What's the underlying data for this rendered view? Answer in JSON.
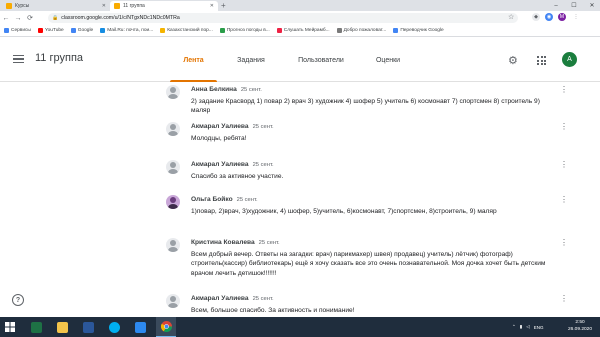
{
  "browser": {
    "tabs": [
      {
        "label": "Курсы"
      },
      {
        "label": "11 группа"
      }
    ],
    "new_tab": "+",
    "window_controls": {
      "minimize": "–",
      "maximize": "☐",
      "close": "✕"
    },
    "url": "classroom.google.com/u/1/c/NTgxNDc1NDc0MTRa",
    "profile_initial": "M",
    "bookmarks": [
      {
        "label": "Сервисы",
        "color": "#4285f4"
      },
      {
        "label": "YouTube",
        "color": "#ff0000"
      },
      {
        "label": "Google",
        "color": "#4285f4"
      },
      {
        "label": "Mail.Ru: почта, пои...",
        "color": "#168de2"
      },
      {
        "label": "Казахстанский пор...",
        "color": "#f5b400"
      },
      {
        "label": "Прогноз погоды в...",
        "color": "#2a9d4a"
      },
      {
        "label": "Слушать Мейрамб...",
        "color": "#e24"
      },
      {
        "label": "Добро пожаловат...",
        "color": "#7a7a7a"
      },
      {
        "label": "Переводчик Google",
        "color": "#4285f4"
      }
    ]
  },
  "classroom": {
    "class_name": "11 группа",
    "tabs": [
      {
        "label": "Лента",
        "active": true
      },
      {
        "label": "Задания",
        "active": false
      },
      {
        "label": "Пользователи",
        "active": false
      },
      {
        "label": "Оценки",
        "active": false
      }
    ],
    "user_initial": "A",
    "accent_color": "#e37400"
  },
  "comments": [
    {
      "author": "Анна Белкина",
      "date": "25 сент.",
      "text": "2) задание  Красворд  1) повар 2) врач 3) художник 4) шофер 5) учитель 6) космонавт 7) спортсмен 8) строитель 9) маляр",
      "photo": false
    },
    {
      "author": "Акмарал Уалиева",
      "date": "25 сент.",
      "text": "Молодцы,  ребята!",
      "photo": false
    },
    {
      "author": "Акмарал Уалиева",
      "date": "25 сент.",
      "text": "Спасибо за активное участие.",
      "photo": false
    },
    {
      "author": "Ольга Бойко",
      "date": "25 сент.",
      "text": "1)повар, 2)врач, 3)художник, 4) шофер, 5)учитель, 6)космонавт, 7)спортсмен, 8)строитель, 9) маляр",
      "photo": true
    },
    {
      "author": "Кристина Ковалева",
      "date": "25 сент.",
      "text": "Всем добрый вечер. Ответы на загадки: врач) парикмахер) швея) продавец) учитель) лётчик) фотограф) строитель(кассир) библиотекарь) ещё я хочу сказать все это очень познавательной. Моя дочка хочет быть детским врачом лечить детишок!!!!!!!",
      "photo": false
    },
    {
      "author": "Акмарал Уалиева",
      "date": "25 сент.",
      "text": "Всем, большое спасибо. За активность и понимание!",
      "photo": false
    }
  ],
  "taskbar": {
    "language": "ENG",
    "time": "2:50",
    "date": "26.09.2020"
  }
}
